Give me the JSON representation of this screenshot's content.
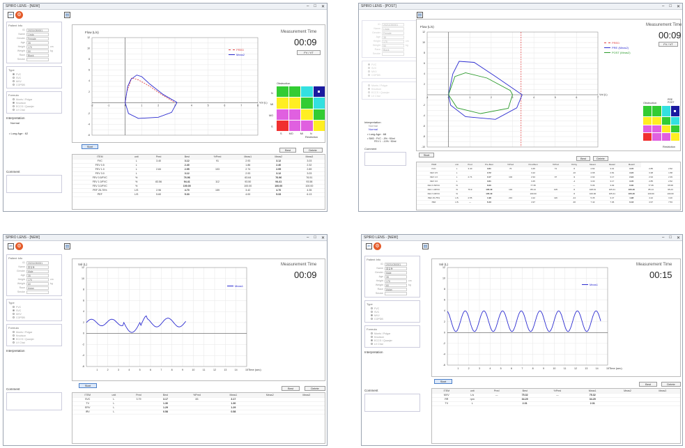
{
  "w1": {
    "title": "SPIRO LENS - [NEW]",
    "patient": {
      "header": "Patient Info",
      "fields": [
        {
          "label": "ID",
          "value": "20211030001"
        },
        {
          "label": "Name",
          "value": "Linda"
        },
        {
          "label": "Gender",
          "value": "Female"
        },
        {
          "label": "Age",
          "value": "35"
        },
        {
          "label": "Height",
          "value": "170",
          "unit": "cm"
        },
        {
          "label": "Weight",
          "value": "50",
          "unit": "kg"
        },
        {
          "label": "Race",
          "value": "Black"
        },
        {
          "label": "Smoke",
          "value": ""
        }
      ]
    },
    "type": {
      "header": "Type",
      "options": [
        "FVC",
        "SVC",
        "MVV",
        "COPDB"
      ],
      "selected": 0
    },
    "formula": {
      "header": "Formula",
      "options": [
        "Morris / Polgar",
        "Knudson",
        "ECCS / Quanjer",
        "LV Chai"
      ],
      "selected": 1
    },
    "interp": {
      "header": "Interpretation",
      "lines": [
        "Normal",
        "",
        "• Lung Age : 62"
      ]
    },
    "comment": "Comment",
    "axis_title": "Flow (L/s)",
    "x_axis": "Vol (L)",
    "mt_label": "Measurement Time",
    "time": "00:09",
    "fvvt_btn": "FV / VT",
    "legend": [
      {
        "name": "PRED",
        "color": "#e04040"
      },
      {
        "name": "Meas2",
        "color": "#2a2ad0"
      }
    ],
    "obstruction": "Obstruction",
    "restriction": "Restriction",
    "start": "Start",
    "best": "Best",
    "delete": "Delete",
    "table": {
      "headers": [
        "ITEM",
        "unit",
        "Pred",
        "Best",
        "%Pred",
        "Meas1",
        "Meas2",
        "Meas3"
      ],
      "rows": [
        [
          "FVC",
          "L",
          "3.40",
          "3.12",
          "91",
          "2.93",
          "3.12",
          "3.03"
        ],
        [
          "FEV 0.5",
          "L",
          "",
          "2.40",
          "",
          "1.86",
          "2.40",
          "2.32"
        ],
        [
          "FEV 1.0",
          "L",
          "2.84",
          "2.95",
          "103",
          "2.74",
          "2.95",
          "2.89"
        ],
        [
          "FEV 3.0",
          "L",
          "",
          "3.12",
          "",
          "2.93",
          "3.12",
          "3.03"
        ],
        [
          "FEV 0.5/FVC",
          "%",
          "",
          "76.96",
          "",
          "63.64",
          "76.96",
          "76.51"
        ],
        [
          "FEV 1.0/FVC",
          "%",
          "83.56",
          "94.41",
          "112",
          "93.50",
          "94.41",
          "93.58"
        ],
        [
          "FEV 3.0/FVC",
          "%",
          "",
          "100.00",
          "",
          "100.00",
          "100.00",
          "100.00"
        ],
        [
          "PEF 25-75%",
          "L/S",
          "2.96",
          "4.70",
          "159",
          "3.42",
          "4.70",
          "4.35"
        ],
        [
          "PEF",
          "L/S",
          "5.60",
          "5.33",
          "",
          "4.00",
          "5.33",
          "6.13"
        ]
      ]
    }
  },
  "w2": {
    "title": "SPIRO LENS - [POST]",
    "axis_title": "Flow (L/s)",
    "x_axis": "Vol (L)",
    "mt_label": "Measurement Time",
    "time": "00:09",
    "fvvt_btn": "FV / VT",
    "legend": [
      {
        "name": "PRED",
        "color": "#e04040"
      },
      {
        "name": "PRE (Meas2)",
        "color": "#2a2ad0"
      },
      {
        "name": "POST (Meas2)",
        "color": "#2a9a2a"
      }
    ],
    "obstruction": "Obstruction",
    "restriction": "Restriction",
    "prepost": [
      "PRE",
      "POST"
    ],
    "interp": {
      "header": "Interpretation",
      "lines": [
        "Normal",
        "Normal",
        "• Lung Age : 68",
        "• SMD : FVC : -5% ~50ml",
        "FEV 1 : -10% ~50ml"
      ]
    },
    "comment": "Comment",
    "start": "Start",
    "best": "Best",
    "delete": "Delete",
    "table": {
      "headers": [
        "ITEM",
        "unit",
        "Pred",
        "Pre-Best",
        "%Pred",
        "Post-Best",
        "%Pred",
        "%Chg",
        "Meas1",
        "Meas2",
        "Meas3"
      ],
      "rows": [
        [
          "FVC",
          "L",
          "3.40",
          "3.61",
          "70",
          "3.45",
          "72",
          "-5",
          "2.82",
          "3.01",
          "3.45",
          "2.85",
          "2.52"
        ],
        [
          "FEV 0.5",
          "L",
          "",
          "3.72",
          "",
          "3.22",
          "",
          "-10",
          "2.68",
          "2.81",
          "3.22",
          "3.38",
          "1.58"
        ],
        [
          "FEV 1.0",
          "L",
          "2.74",
          "3.17",
          "102",
          "2.94",
          "97",
          "-9",
          "2.92",
          "3.17",
          "2.94",
          "2.94",
          "2.39"
        ],
        [
          "FEV 3.0",
          "L",
          "",
          "3.61",
          "",
          "3.45",
          "",
          "-4",
          "3.00",
          "3.17",
          "3.45",
          "2.85",
          "2.52"
        ],
        [
          "FEV 0.5/FVC",
          "%",
          "",
          "6.00",
          "",
          "77.35",
          "",
          "—",
          "5.06",
          "3.93",
          "6.00",
          "77.35",
          "65.58"
        ],
        [
          "FEV 1.0/FVC",
          "%",
          "79.9",
          "105.40",
          "132",
          "85.14",
          "105",
          "-5",
          "108.01",
          "105.41",
          "105.40",
          "85.14",
          "95.23"
        ],
        [
          "FEV 3.0/FVC",
          "%",
          "",
          "105.40",
          "",
          "100.00",
          "",
          "-5",
          "100.00",
          "105.41",
          "105.40",
          "100.00",
          "100.00"
        ],
        [
          "PEF 25-75%",
          "L/S",
          "2.55",
          "1.98",
          "210",
          "4.22",
          "119",
          "-44",
          "5.35",
          "3.47",
          "1.98",
          "4.22",
          "3.20"
        ],
        [
          "PEF",
          "L/S",
          "—",
          "6.43",
          "",
          "4.97",
          "",
          "-30",
          "7.42",
          "7.06",
          "6.43",
          "4.97",
          "7.53"
        ]
      ]
    }
  },
  "w3": {
    "title": "SPIRO LENS - [NEW]",
    "patient": {
      "header": "Patient Info",
      "fields": [
        {
          "label": "ID",
          "value": "20211030001"
        },
        {
          "label": "Name",
          "value": "홍길동"
        },
        {
          "label": "Gender",
          "value": "Male"
        },
        {
          "label": "Age",
          "value": "35"
        },
        {
          "label": "Height",
          "value": "170",
          "unit": "cm"
        },
        {
          "label": "Weight",
          "value": "60",
          "unit": "kg"
        },
        {
          "label": "Race",
          "value": "Asian"
        },
        {
          "label": "Smoke",
          "value": ""
        }
      ]
    },
    "type": {
      "header": "Type",
      "options": [
        "FVC",
        "SVC",
        "MVV",
        "COPDB"
      ],
      "selected": 1
    },
    "formula": {
      "header": "Formula",
      "options": [
        "Morris / Polgar",
        "Knudson",
        "ECCS / Quanjer",
        "LV Chai"
      ],
      "selected": 2
    },
    "interp_header": "Interpretation",
    "comment": "Comment",
    "axis_title": "Vol (L)",
    "x_axis": "Time (sec)",
    "mt_label": "Measurement Time",
    "time": "00:09",
    "legend": [
      {
        "name": "Meas1",
        "color": "#2a2ad0"
      }
    ],
    "start": "Start",
    "best": "Best",
    "delete": "Delete",
    "table": {
      "headers": [
        "ITEM",
        "unit",
        "Pred",
        "Best",
        "%Pred",
        "Meas1",
        "Meas2",
        "Meas3"
      ],
      "rows": [
        [
          "SVC",
          "L",
          "3.79",
          "3.17",
          "83",
          "3.17",
          "",
          ""
        ],
        [
          "TV",
          "L",
          "",
          "1.30",
          "",
          "1.30",
          "",
          ""
        ],
        [
          "ERV",
          "L",
          "",
          "1.29",
          "",
          "1.29",
          "",
          ""
        ],
        [
          "IRV",
          "L",
          "",
          "0.58",
          "",
          "0.58",
          "",
          ""
        ]
      ]
    }
  },
  "w4": {
    "title": "SPIRO LENS - [NEW]",
    "patient": {
      "header": "Patient Info",
      "fields": [
        {
          "label": "ID",
          "value": "20211030001"
        },
        {
          "label": "Name",
          "value": "홍길동"
        },
        {
          "label": "Gender",
          "value": "Male"
        },
        {
          "label": "Age",
          "value": "35"
        },
        {
          "label": "Height",
          "value": "170",
          "unit": "cm"
        },
        {
          "label": "Weight",
          "value": "60",
          "unit": "kg"
        },
        {
          "label": "Race",
          "value": "Asian"
        },
        {
          "label": "Smoke",
          "value": ""
        }
      ]
    },
    "type": {
      "header": "Type",
      "options": [
        "FVC",
        "SVC",
        "MVV",
        "COPDB"
      ],
      "selected": 2
    },
    "formula": {
      "header": "Formula",
      "options": [
        "Morris / Polgar",
        "Knudson",
        "ECCS / Quanjer",
        "LV Chai"
      ],
      "selected": 2
    },
    "interp_header": "Interpretation",
    "comment": "Comment",
    "axis_title": "Vol (L)",
    "x_axis": "Time (sec)",
    "mt_label": "Measurement Time",
    "time": "00:15",
    "legend": [
      {
        "name": "Meas1",
        "color": "#2a2ad0"
      }
    ],
    "start": "Start",
    "best": "Best",
    "delete": "Delete",
    "table": {
      "headers": [
        "ITEM",
        "unit",
        "Pred",
        "Best",
        "%Pred",
        "Meas1",
        "Meas2",
        "Meas3"
      ],
      "rows": [
        [
          "MVV",
          "L/s",
          "—",
          "75.32",
          "—",
          "75.32",
          "",
          ""
        ],
        [
          "RR",
          "rpm",
          "",
          "34.29",
          "",
          "34.29",
          "",
          ""
        ],
        [
          "TV",
          "L",
          "",
          "2.31",
          "",
          "2.31",
          "",
          ""
        ]
      ]
    }
  }
}
